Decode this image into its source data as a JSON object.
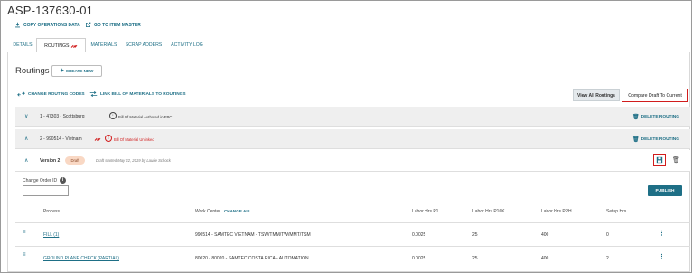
{
  "header": {
    "title": "ASP-137630-01",
    "copy_operations": "COPY OPERATIONS DATA",
    "go_to_item_master": "GO TO ITEM MASTER"
  },
  "tabs": [
    {
      "label": "DETAILS"
    },
    {
      "label": "ROUTINGS"
    },
    {
      "label": "MATERIALS"
    },
    {
      "label": "SCRAP ADDERS"
    },
    {
      "label": "ACTIVITY LOG"
    }
  ],
  "routings": {
    "title": "Routings",
    "create_new": "CREATE NEW",
    "change_routing_codes": "CHANGE ROUTING CODES",
    "link_bom": "LINK BILL OF MATERIALS TO ROUTINGS",
    "view_all": "View All Routings",
    "compare": "Compare Draft To Current",
    "delete_label": "DELETE ROUTING",
    "rows": [
      {
        "label": "1 - 47303 - Scottsburg",
        "bom_status": "Bill Of Material Authored in EPC"
      },
      {
        "label": "2 - 990514 - Vietnam",
        "bom_status": "Bill Of Material Unlinked"
      }
    ]
  },
  "version": {
    "label": "Version 2",
    "badge": "Draft",
    "note": "Draft started May 22, 2019 by Laurie Schock"
  },
  "change_order": {
    "label": "Change Order ID",
    "value": "",
    "publish": "PUBLISH"
  },
  "table": {
    "headers": {
      "process": "Process",
      "work_center": "Work Center",
      "change_all": "CHANGE ALL",
      "labor_p1": "Labor Hrs P1",
      "labor_p10k": "Labor Hrs P10K",
      "labor_pph": "Labor Hrs PPH",
      "setup": "Setup Hrs"
    },
    "rows": [
      {
        "process": "FILL (1)",
        "work_center": "990514 - SAMTEC VIETNAM - TSW/TMM/TW/MMT/TSM",
        "p1": "0.0025",
        "p10k": "25",
        "pph": "400",
        "setup": "0"
      },
      {
        "process": "GROUND PLANE CHECK (PARTIAL)",
        "work_center": "80020 - 80020 - SAMTEC COSTA RICA - AUTOMATION",
        "p1": "0.0025",
        "p10k": "25",
        "pph": "400",
        "setup": "2"
      }
    ]
  },
  "colors": {
    "accent": "#1e6f86",
    "alert": "#d11c1c"
  }
}
